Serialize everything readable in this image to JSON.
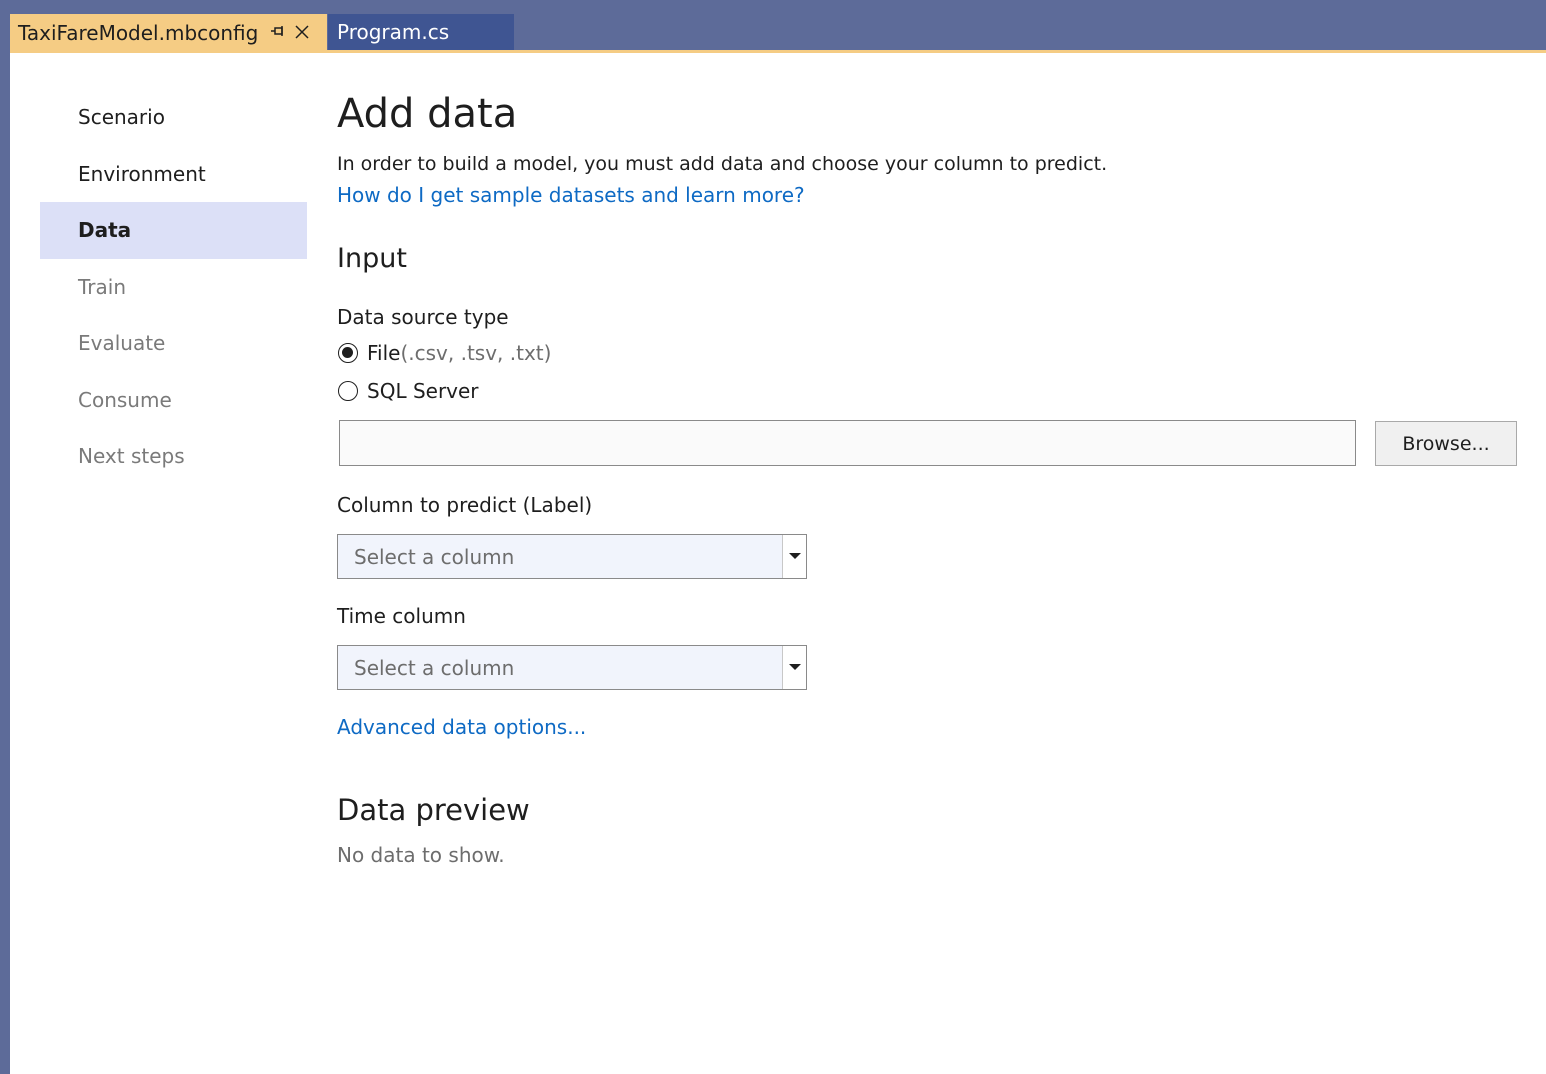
{
  "tabs": {
    "active": {
      "label": "TaxiFareModel.mbconfig",
      "pin": "⊣",
      "close": "×"
    },
    "inactive": {
      "label": "Program.cs"
    }
  },
  "nav": {
    "items": [
      {
        "label": "Scenario",
        "state": "enabled"
      },
      {
        "label": "Environment",
        "state": "enabled"
      },
      {
        "label": "Data",
        "state": "selected"
      },
      {
        "label": "Train",
        "state": "disabled"
      },
      {
        "label": "Evaluate",
        "state": "disabled"
      },
      {
        "label": "Consume",
        "state": "disabled"
      },
      {
        "label": "Next steps",
        "state": "disabled"
      }
    ]
  },
  "main": {
    "title": "Add data",
    "description": "In order to build a model, you must add data and choose your column to predict.",
    "help_link": "How do I get sample datasets and learn more?",
    "input_heading": "Input",
    "data_source_label": "Data source type",
    "radio_file_label": "File",
    "radio_file_ext": " (.csv, .tsv, .txt)",
    "radio_sql_label": "SQL Server",
    "file_path_value": "",
    "browse_label": "Browse...",
    "label_column_heading": "Column to predict (Label)",
    "label_column_placeholder": "Select a column",
    "time_column_heading": "Time column",
    "time_column_placeholder": "Select a column",
    "advanced_link": "Advanced data options...",
    "preview_heading": "Data preview",
    "preview_empty": "No data to show."
  },
  "colors": {
    "active_tab": "#f5cc84",
    "inactive_tab": "#3f5592",
    "chrome": "#5d6b99",
    "nav_selected": "#dce0f7",
    "link": "#0e6ac4"
  }
}
